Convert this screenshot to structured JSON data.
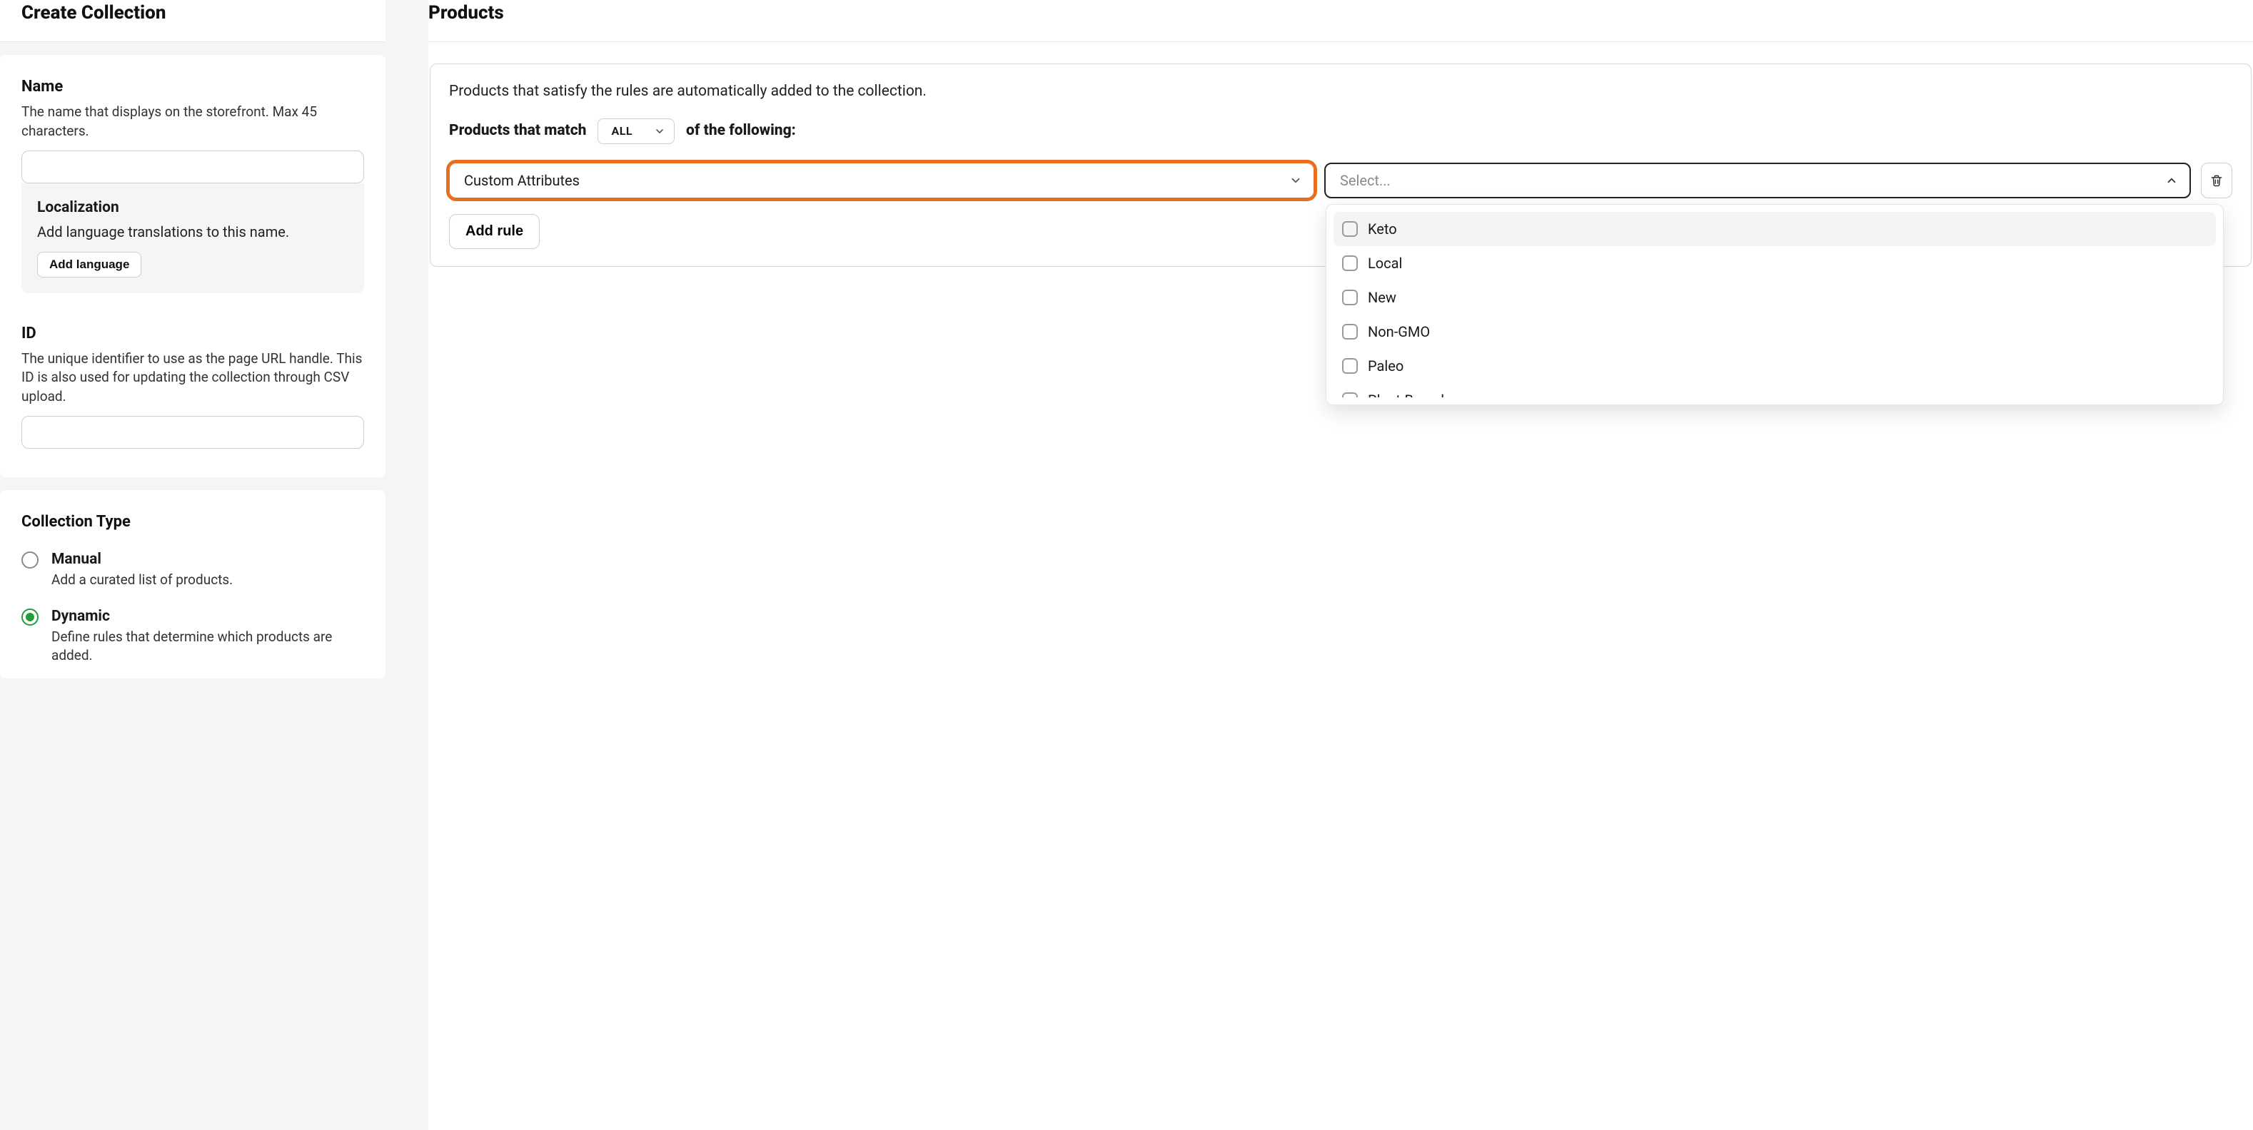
{
  "left": {
    "page_title": "Create Collection",
    "name": {
      "label": "Name",
      "help": "The name that displays on the storefront. Max 45 characters.",
      "value": ""
    },
    "localization": {
      "title": "Localization",
      "desc": "Add language translations to this name.",
      "button": "Add language"
    },
    "id": {
      "label": "ID",
      "help": "The unique identifier to use as the page URL handle. This ID is also used for updating the collection through CSV upload.",
      "value": ""
    },
    "collection_type": {
      "title": "Collection Type",
      "options": [
        {
          "title": "Manual",
          "desc": "Add a curated list of products.",
          "selected": false
        },
        {
          "title": "Dynamic",
          "desc": "Define rules that determine which products are added.",
          "selected": true
        }
      ]
    }
  },
  "right": {
    "page_title": "Products",
    "rules_intro": "Products that satisfy the rules are automatically added to the collection.",
    "match_prefix": "Products that match",
    "match_mode": "ALL",
    "match_suffix": "of the following:",
    "rule": {
      "attribute_value": "Custom Attributes",
      "value_placeholder": "Select...",
      "options": [
        "Keto",
        "Local",
        "New",
        "Non-GMO",
        "Paleo",
        "Plant-Based"
      ],
      "highlighted_index": 0
    },
    "add_rule_label": "Add rule"
  }
}
